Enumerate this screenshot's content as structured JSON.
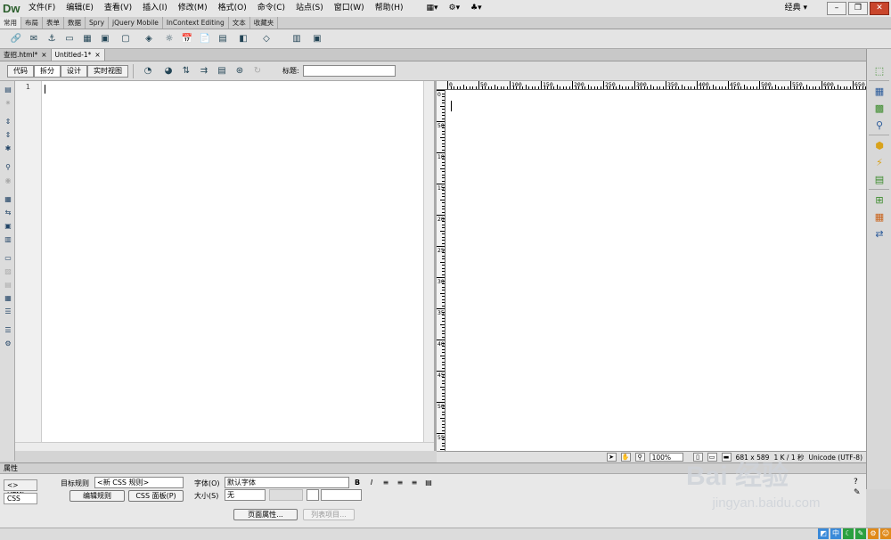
{
  "app": {
    "logo": "Dw"
  },
  "menu": {
    "items": [
      "文件(F)",
      "编辑(E)",
      "查看(V)",
      "插入(I)",
      "修改(M)",
      "格式(O)",
      "命令(C)",
      "站点(S)",
      "窗口(W)",
      "帮助(H)"
    ],
    "workspace": "经典 ▾",
    "window_buttons": [
      "–",
      "❐",
      "✕"
    ]
  },
  "insert_tabs": [
    "常用",
    "布局",
    "表单",
    "数据",
    "Spry",
    "jQuery Mobile",
    "InContext Editing",
    "文本",
    "收藏夹"
  ],
  "insert_tools": [
    "🔗",
    "✉",
    "⚓",
    "▭",
    "▦",
    "▣",
    "▢",
    "◈",
    "☼",
    "📅",
    "📄",
    "▤",
    "◧",
    "◇",
    "▥",
    "▣"
  ],
  "doc_tabs": [
    {
      "label": "查招.html*",
      "close": "×"
    },
    {
      "label": "Untitled-1*",
      "close": "×"
    }
  ],
  "doc_toolbar": {
    "views": [
      "代码",
      "拆分",
      "设计",
      "实时视图"
    ],
    "active_view": "拆分",
    "title_label": "标题:",
    "title_value": "",
    "tools": [
      "◔",
      "◕",
      "⇅",
      "⇉",
      "▤",
      "⊛",
      "↻"
    ]
  },
  "left_tools": [
    "▤",
    "✷",
    "⇕",
    "⇕",
    "✱",
    "⚲",
    "◉",
    "▦",
    "⇆",
    "▣",
    "▥",
    "▭",
    "▨",
    "▤",
    "▦",
    "☰",
    "☰",
    "⚙"
  ],
  "code": {
    "line_number": "1"
  },
  "ruler": {
    "h_labels": [
      "0",
      "50",
      "100",
      "150",
      "200",
      "250",
      "300",
      "350",
      "400",
      "450",
      "500",
      "550",
      "600",
      "650"
    ],
    "v_labels": [
      "0",
      "50",
      "100",
      "150",
      "200",
      "250",
      "300",
      "350",
      "400",
      "450",
      "500",
      "550"
    ]
  },
  "status": {
    "zoom": "100%",
    "size": "681 x 589",
    "file": "1 K / 1 秒",
    "encoding": "Unicode (UTF-8)"
  },
  "right_panel_icons": [
    "⬚",
    "▦",
    "▩",
    "⚲",
    "⬢",
    "⚡",
    "▤",
    "⊞",
    "▦",
    "⇄"
  ],
  "properties": {
    "panel_title": "属性",
    "html_tab": "<> HTML",
    "css_tab": "CSS",
    "target_rule_label": "目标规则",
    "target_rule_value": "<新 CSS 规则>",
    "edit_rule": "编辑规则",
    "css_panel": "CSS 面板(P)",
    "font_label": "字体(O)",
    "font_value": "默认字体",
    "size_label": "大小(S)",
    "size_value": "无",
    "bold": "B",
    "italic": "I",
    "page_props": "页面属性...",
    "list_items": "列表项目..."
  },
  "taskbar": {
    "tray": [
      "中"
    ]
  },
  "watermark": {
    "line1": "Bai 经验",
    "line2": "jingyan.baidu.com"
  }
}
